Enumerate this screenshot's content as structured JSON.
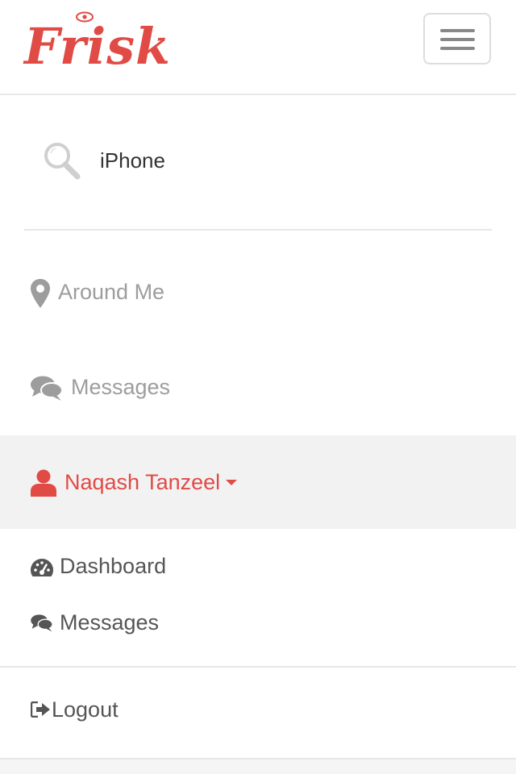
{
  "brand": {
    "name": "Frisk",
    "color": "#e04b46"
  },
  "navbar": {
    "toggle_icon": "hamburger-icon"
  },
  "search": {
    "icon": "search-icon",
    "value": "iPhone"
  },
  "nav": {
    "items": [
      {
        "label": "Around Me",
        "icon": "map-marker-icon"
      },
      {
        "label": "Messages",
        "icon": "comments-icon"
      }
    ],
    "user": {
      "label": "Naqash Tanzeel",
      "icon": "user-icon",
      "caret_icon": "caret-down-icon"
    }
  },
  "dropdown": {
    "items": [
      {
        "label": "Dashboard",
        "icon": "dashboard-icon"
      },
      {
        "label": "Messages",
        "icon": "comments-icon"
      }
    ]
  },
  "logout": {
    "label": "Logout",
    "icon": "sign-out-icon"
  },
  "colors": {
    "accent": "#e04b46",
    "muted_text": "#9d9d9d",
    "body_text": "#555555",
    "highlight_bg": "#f2f2f2",
    "divider": "#e7e7e7"
  }
}
